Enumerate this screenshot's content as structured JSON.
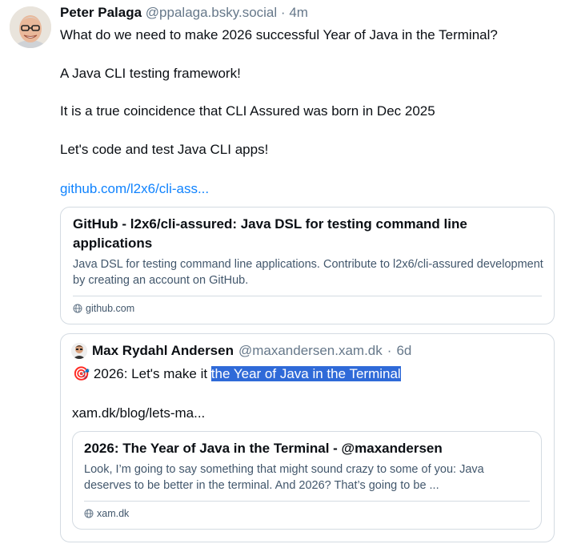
{
  "post": {
    "author_name": "Peter Palaga",
    "author_handle": "@ppalaga.bsky.social",
    "separator": "·",
    "time": "4m",
    "lines": [
      "What do we need to make 2026 successful Year of Java in the Terminal?",
      "A Java CLI testing framework!",
      "It is a true coincidence that CLI Assured was born in Dec 2025",
      "Let's code and test Java CLI apps!"
    ],
    "link": "github.com/l2x6/cli-ass..."
  },
  "link_card": {
    "title": "GitHub - l2x6/cli-assured: Java DSL for testing command line applications",
    "description": "Java DSL for testing command line applications. Contribute to l2x6/cli-assured development by creating an account on GitHub.",
    "domain": "github.com"
  },
  "quote": {
    "author_name": "Max Rydahl Andersen",
    "author_handle": "@maxandersen.xam.dk",
    "separator": "·",
    "time": "6d",
    "emoji": "🎯",
    "text_before": "2026: Let's make it ",
    "text_selected": "the Year of Java in the Terminal",
    "link": "xam.dk/blog/lets-ma...",
    "card": {
      "title": "2026: The Year of Java in the Terminal - @maxandersen",
      "description": "Look, I’m going to say something that might sound crazy to some of you: Java deserves to be better in the terminal. And 2026? That’s going to be ...",
      "domain": "xam.dk"
    }
  },
  "colors": {
    "link": "#1083fe",
    "selection": "#2f6ad8",
    "muted": "#66788a",
    "border": "#d4dbe2"
  }
}
